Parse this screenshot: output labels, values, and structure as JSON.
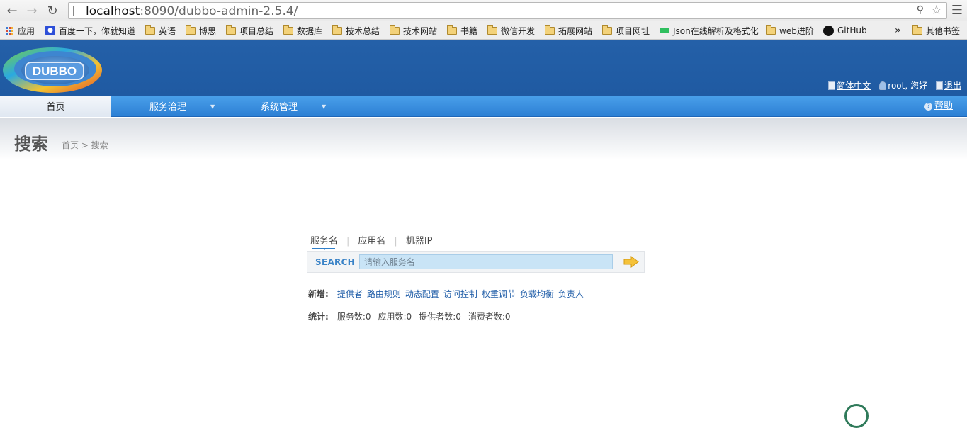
{
  "browser": {
    "url_host": "localhost",
    "url_rest": ":8090/dubbo-admin-2.5.4/",
    "bookmarks": [
      {
        "label": "应用",
        "type": "apps"
      },
      {
        "label": "百度一下，你就知道",
        "type": "baidu"
      },
      {
        "label": "英语",
        "type": "folder"
      },
      {
        "label": "博思",
        "type": "folder"
      },
      {
        "label": "项目总结",
        "type": "folder"
      },
      {
        "label": "数据库",
        "type": "folder"
      },
      {
        "label": "技术总结",
        "type": "folder"
      },
      {
        "label": "技术网站",
        "type": "folder"
      },
      {
        "label": "书籍",
        "type": "folder"
      },
      {
        "label": "微信开发",
        "type": "folder"
      },
      {
        "label": "拓展网站",
        "type": "folder"
      },
      {
        "label": "项目网址",
        "type": "folder"
      },
      {
        "label": "Json在线解析及格式化",
        "type": "json"
      },
      {
        "label": "web进阶",
        "type": "folder"
      },
      {
        "label": "GitHub",
        "type": "github"
      },
      {
        "label": "其他书签",
        "type": "folder"
      }
    ],
    "overflow": "»"
  },
  "header": {
    "logo_text": "DUBBO",
    "language_link": "简体中文",
    "greeting": "root, 您好",
    "logout_link": "退出"
  },
  "nav": {
    "home": "首页",
    "service_governance": "服务治理",
    "system_management": "系统管理",
    "help": "帮助"
  },
  "page": {
    "title": "搜索",
    "breadcrumb": "首页 > 搜索"
  },
  "search": {
    "tabs": [
      "服务名",
      "应用名",
      "机器IP"
    ],
    "active_tab": 0,
    "label": "SEARCH",
    "placeholder": "请输入服务名"
  },
  "create": {
    "label": "新增:",
    "links": [
      "提供者",
      "路由规则",
      "动态配置",
      "访问控制",
      "权重调节",
      "负载均衡",
      "负责人"
    ]
  },
  "stats": {
    "label": "统计:",
    "items": [
      "服务数:0",
      "应用数:0",
      "提供者数:0",
      "消费者数:0"
    ]
  },
  "colors": {
    "header_blue": "#2460a8",
    "nav_blue": "#2c7fd4",
    "link_blue": "#1f5da8",
    "search_label": "#3a83c7"
  }
}
